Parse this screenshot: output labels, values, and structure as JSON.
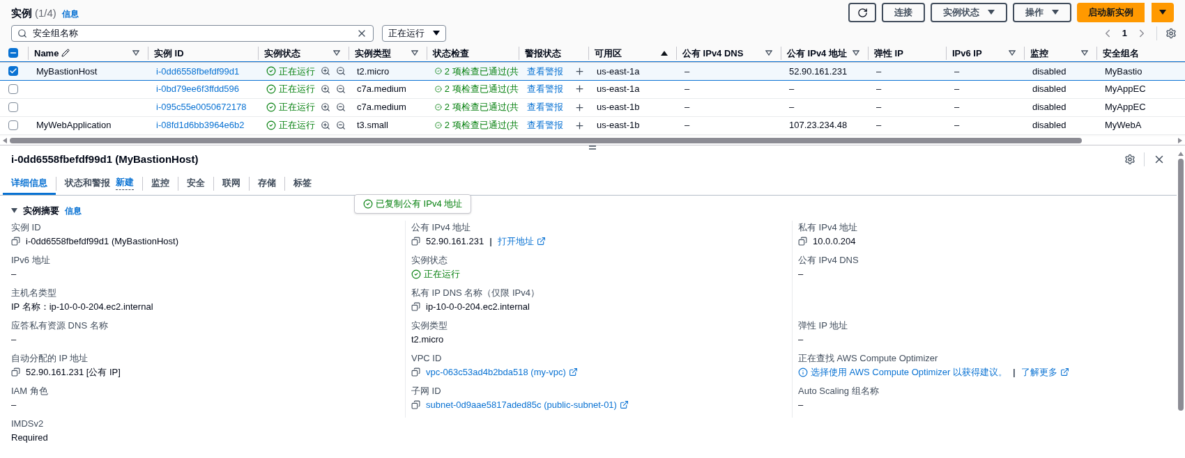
{
  "header": {
    "title": "实例",
    "count": "(1/4)",
    "info": "信息",
    "buttons": [
      {
        "kind": "icon"
      },
      {
        "kind": "plain",
        "label": "连接"
      },
      {
        "kind": "dropdown",
        "label": "实例状态"
      },
      {
        "kind": "dropdown",
        "label": "操作"
      },
      {
        "kind": "primary",
        "label": "启动新实例"
      },
      {
        "kind": "split"
      }
    ]
  },
  "search": {
    "value": "安全组名称"
  },
  "state_filter": {
    "value": "正在运行"
  },
  "pagination": {
    "page": "1"
  },
  "table": {
    "select_all_partial": true,
    "columns": [
      {
        "label": "Name",
        "editable": true,
        "sortable": true,
        "sorted": false
      },
      {
        "label": "实例 ID",
        "editable": false,
        "sortable": false,
        "sorted": false
      },
      {
        "label": "实例状态",
        "editable": false,
        "sortable": true,
        "sorted": false
      },
      {
        "label": "实例类型",
        "editable": false,
        "sortable": true,
        "sorted": false
      },
      {
        "label": "状态检查",
        "editable": false,
        "sortable": false,
        "sorted": false
      },
      {
        "label": "警报状态",
        "editable": false,
        "sortable": false,
        "sorted": false
      },
      {
        "label": "可用区",
        "editable": false,
        "sortable": false,
        "sorted": true
      },
      {
        "label": "公有 IPv4 DNS",
        "editable": false,
        "sortable": true,
        "sorted": false
      },
      {
        "label": "公有 IPv4 地址",
        "editable": false,
        "sortable": true,
        "sorted": false
      },
      {
        "label": "弹性 IP",
        "editable": false,
        "sortable": false,
        "sorted": false
      },
      {
        "label": "IPv6 IP",
        "editable": false,
        "sortable": true,
        "sorted": false
      },
      {
        "label": "监控",
        "editable": false,
        "sortable": true,
        "sorted": false
      },
      {
        "label": "安全组名",
        "editable": false,
        "sortable": false,
        "sorted": false
      }
    ],
    "rows": [
      {
        "selected": true,
        "name": "MyBastionHost",
        "instance_id": "i-0dd6558fbefdf99d1",
        "state": "正在运行",
        "type": "t2.micro",
        "status_check": "2 项检查已通过(共",
        "alarm": "查看警报",
        "az": "us-east-1a",
        "public_dns": "–",
        "public_ip": "52.90.161.231",
        "elastic_ip": "–",
        "ipv6": "–",
        "monitoring": "disabled",
        "security_group": "MyBastio"
      },
      {
        "selected": false,
        "name": "",
        "instance_id": "i-0bd79ee6f3ffdd596",
        "state": "正在运行",
        "type": "c7a.medium",
        "status_check": "2 项检查已通过(共",
        "alarm": "查看警报",
        "az": "us-east-1a",
        "public_dns": "–",
        "public_ip": "–",
        "elastic_ip": "–",
        "ipv6": "–",
        "monitoring": "disabled",
        "security_group": "MyAppEC"
      },
      {
        "selected": false,
        "name": "",
        "instance_id": "i-095c55e0050672178",
        "state": "正在运行",
        "type": "c7a.medium",
        "status_check": "2 项检查已通过(共",
        "alarm": "查看警报",
        "az": "us-east-1b",
        "public_dns": "–",
        "public_ip": "–",
        "elastic_ip": "–",
        "ipv6": "–",
        "monitoring": "disabled",
        "security_group": "MyAppEC"
      },
      {
        "selected": false,
        "name": "MyWebApplication",
        "instance_id": "i-08fd1d6bb3964e6b2",
        "state": "正在运行",
        "type": "t3.small",
        "status_check": "2 项检查已通过(共",
        "alarm": "查看警报",
        "az": "us-east-1b",
        "public_dns": "–",
        "public_ip": "107.23.234.48",
        "elastic_ip": "–",
        "ipv6": "–",
        "monitoring": "disabled",
        "security_group": "MyWebA"
      }
    ]
  },
  "detail": {
    "title": "i-0dd6558fbefdf99d1 (MyBastionHost)",
    "tabs": [
      {
        "label": "详细信息",
        "selected": true
      },
      {
        "label": "状态和警报",
        "badge": "新建",
        "selected": false
      },
      {
        "label": "监控",
        "selected": false
      },
      {
        "label": "安全",
        "selected": false
      },
      {
        "label": "联网",
        "selected": false
      },
      {
        "label": "存储",
        "selected": false
      },
      {
        "label": "标签",
        "selected": false
      }
    ],
    "section": {
      "title": "实例摘要",
      "info": "信息",
      "expanded": true
    },
    "toast": {
      "text": "已复制公有 IPv4 地址"
    },
    "field_rows": [
      [
        {
          "label": "实例 ID",
          "kind": "copy",
          "parts": [
            {
              "kind": "text",
              "text": "i-0dd6558fbefdf99d1 (MyBastionHost)"
            }
          ]
        },
        {
          "label": "公有 IPv4 地址",
          "kind": "copy",
          "parts": [
            {
              "kind": "text",
              "text": "52.90.161.231"
            },
            {
              "kind": "separator",
              "text": "|"
            },
            {
              "kind": "link",
              "text": "打开地址",
              "external": true
            }
          ]
        },
        {
          "label": "私有 IPv4 地址",
          "kind": "copy",
          "parts": [
            {
              "kind": "text",
              "text": "10.0.0.204"
            }
          ]
        }
      ],
      [
        {
          "label": "IPv6 地址",
          "kind": "plain",
          "parts": [
            {
              "kind": "text",
              "text": "–"
            }
          ]
        },
        {
          "label": "实例状态",
          "kind": "status",
          "parts": [
            {
              "kind": "status",
              "text": "正在运行"
            }
          ]
        },
        {
          "label": "公有 IPv4 DNS",
          "kind": "plain",
          "parts": [
            {
              "kind": "text",
              "text": "–"
            }
          ]
        }
      ],
      [
        {
          "label": "主机名类型",
          "kind": "plain",
          "parts": [
            {
              "kind": "text",
              "text": "IP 名称：ip-10-0-0-204.ec2.internal"
            }
          ]
        },
        {
          "label": "私有 IP DNS 名称（仅限 IPv4）",
          "kind": "copy",
          "parts": [
            {
              "kind": "text",
              "text": "ip-10-0-0-204.ec2.internal"
            }
          ]
        },
        null
      ],
      [
        {
          "label": "应答私有资源 DNS 名称",
          "kind": "plain",
          "parts": [
            {
              "kind": "text",
              "text": "–"
            }
          ]
        },
        {
          "label": "实例类型",
          "kind": "plain",
          "parts": [
            {
              "kind": "text",
              "text": "t2.micro"
            }
          ]
        },
        {
          "label": "弹性 IP 地址",
          "kind": "plain",
          "parts": [
            {
              "kind": "text",
              "text": "–"
            }
          ]
        }
      ],
      [
        {
          "label": "自动分配的 IP 地址",
          "kind": "copy",
          "parts": [
            {
              "kind": "text",
              "text": "52.90.161.231 [公有 IP]"
            }
          ]
        },
        {
          "label": "VPC ID",
          "kind": "copy",
          "parts": [
            {
              "kind": "link",
              "text": "vpc-063c53ad4b2bda518 (my-vpc)",
              "external": true
            }
          ]
        },
        {
          "label": "正在查找 AWS Compute Optimizer",
          "kind": "info",
          "parts": [
            {
              "kind": "link",
              "text": "选择使用 AWS Compute Optimizer 以获得建议。",
              "external": false
            },
            {
              "kind": "separator",
              "text": "|"
            },
            {
              "kind": "link",
              "text": "了解更多",
              "external": true
            }
          ]
        }
      ],
      [
        {
          "label": "IAM 角色",
          "kind": "plain",
          "parts": [
            {
              "kind": "text",
              "text": "–"
            }
          ]
        },
        {
          "label": "子网 ID",
          "kind": "copy",
          "parts": [
            {
              "kind": "link",
              "text": "subnet-0d9aae5817aded85c (public-subnet-01)",
              "external": true
            }
          ]
        },
        {
          "label": "Auto Scaling 组名称",
          "kind": "plain",
          "parts": [
            {
              "kind": "text",
              "text": "–"
            }
          ]
        }
      ],
      [
        {
          "label": "IMDSv2",
          "kind": "plain",
          "parts": [
            {
              "kind": "text",
              "text": "Required"
            }
          ]
        },
        null,
        null
      ]
    ]
  }
}
